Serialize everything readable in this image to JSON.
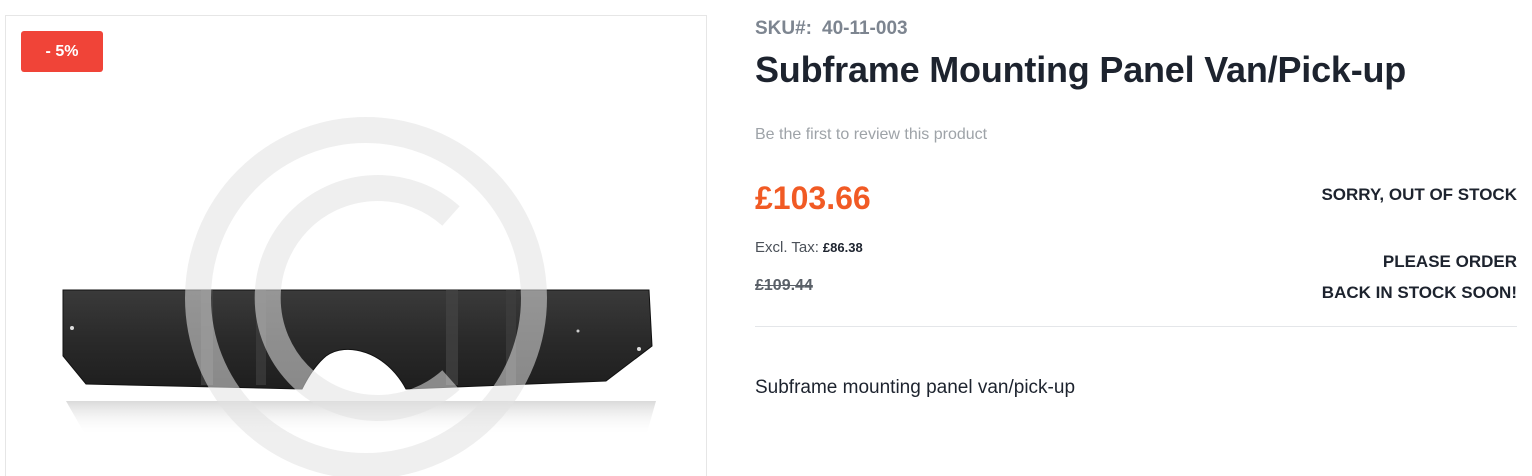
{
  "gallery": {
    "badge": "- 5%"
  },
  "product": {
    "sku_label": "SKU#:",
    "sku_value": "40-11-003",
    "title": "Subframe Mounting Panel Van/Pick-up",
    "review_link": "Be the first to review this product",
    "price": "£103.66",
    "excl_tax_label": "Excl. Tax:",
    "excl_tax_value": "£86.38",
    "old_price": "£109.44",
    "stock_status": "SORRY, OUT OF STOCK",
    "stock_note_line1": "PLEASE ORDER",
    "stock_note_line2": "BACK IN STOCK SOON!",
    "description": "Subframe mounting panel van/pick-up"
  },
  "colors": {
    "badge": "#f04438",
    "price": "#f15a24",
    "text": "#1d232e",
    "muted": "#9ea3a8"
  },
  "icons": {
    "watermark": "copyright-icon"
  }
}
